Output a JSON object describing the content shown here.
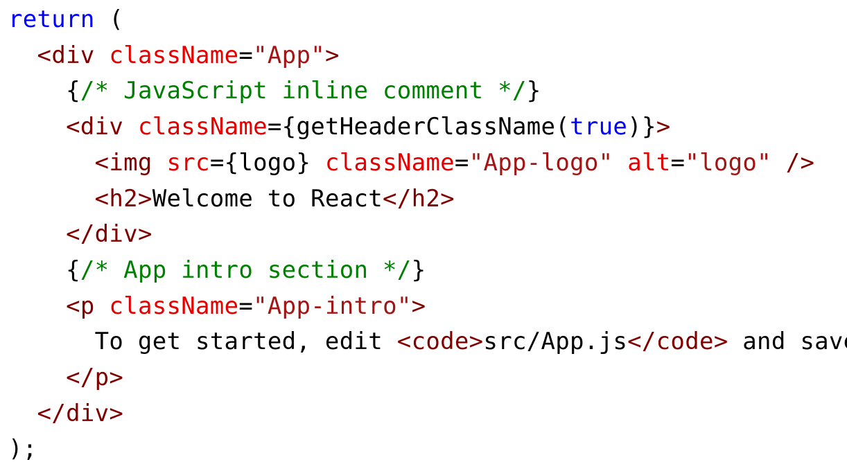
{
  "colors": {
    "plain": "#000000",
    "keyword": "#0000ff",
    "tag": "#800000",
    "attr": "#e50000",
    "string": "#a31515",
    "comment": "#008000",
    "background": "#ffffff"
  },
  "code": {
    "language": "jsx",
    "lines": [
      {
        "tokens": [
          {
            "t": "keyword",
            "v": "return"
          },
          {
            "t": "plain",
            "v": " ("
          }
        ]
      },
      {
        "tokens": [
          {
            "t": "plain",
            "v": "  "
          },
          {
            "t": "tag",
            "v": "<div"
          },
          {
            "t": "plain",
            "v": " "
          },
          {
            "t": "attr",
            "v": "className"
          },
          {
            "t": "plain",
            "v": "="
          },
          {
            "t": "string",
            "v": "\"App\""
          },
          {
            "t": "tag",
            "v": ">"
          }
        ]
      },
      {
        "tokens": [
          {
            "t": "plain",
            "v": "    {"
          },
          {
            "t": "comment",
            "v": "/* JavaScript inline comment */"
          },
          {
            "t": "plain",
            "v": "}"
          }
        ]
      },
      {
        "tokens": [
          {
            "t": "plain",
            "v": "    "
          },
          {
            "t": "tag",
            "v": "<div"
          },
          {
            "t": "plain",
            "v": " "
          },
          {
            "t": "attr",
            "v": "className"
          },
          {
            "t": "plain",
            "v": "={getHeaderClassName("
          },
          {
            "t": "keyword",
            "v": "true"
          },
          {
            "t": "plain",
            "v": ")}"
          },
          {
            "t": "tag",
            "v": ">"
          }
        ]
      },
      {
        "tokens": [
          {
            "t": "plain",
            "v": "      "
          },
          {
            "t": "tag",
            "v": "<img"
          },
          {
            "t": "plain",
            "v": " "
          },
          {
            "t": "attr",
            "v": "src"
          },
          {
            "t": "plain",
            "v": "={logo} "
          },
          {
            "t": "attr",
            "v": "className"
          },
          {
            "t": "plain",
            "v": "="
          },
          {
            "t": "string",
            "v": "\"App-logo\""
          },
          {
            "t": "plain",
            "v": " "
          },
          {
            "t": "attr",
            "v": "alt"
          },
          {
            "t": "plain",
            "v": "="
          },
          {
            "t": "string",
            "v": "\"logo\""
          },
          {
            "t": "plain",
            "v": " "
          },
          {
            "t": "tag",
            "v": "/>"
          }
        ]
      },
      {
        "tokens": [
          {
            "t": "plain",
            "v": "      "
          },
          {
            "t": "tag",
            "v": "<h2>"
          },
          {
            "t": "plain",
            "v": "Welcome to React"
          },
          {
            "t": "tag",
            "v": "</h2>"
          }
        ]
      },
      {
        "tokens": [
          {
            "t": "plain",
            "v": "    "
          },
          {
            "t": "tag",
            "v": "</div>"
          }
        ]
      },
      {
        "tokens": [
          {
            "t": "plain",
            "v": "    {"
          },
          {
            "t": "comment",
            "v": "/* App intro section */"
          },
          {
            "t": "plain",
            "v": "}"
          }
        ]
      },
      {
        "tokens": [
          {
            "t": "plain",
            "v": "    "
          },
          {
            "t": "tag",
            "v": "<p"
          },
          {
            "t": "plain",
            "v": " "
          },
          {
            "t": "attr",
            "v": "className"
          },
          {
            "t": "plain",
            "v": "="
          },
          {
            "t": "string",
            "v": "\"App-intro\""
          },
          {
            "t": "tag",
            "v": ">"
          }
        ]
      },
      {
        "tokens": [
          {
            "t": "plain",
            "v": "      To get started, edit "
          },
          {
            "t": "tag",
            "v": "<code>"
          },
          {
            "t": "plain",
            "v": "src/App.js"
          },
          {
            "t": "tag",
            "v": "</code>"
          },
          {
            "t": "plain",
            "v": " and save"
          }
        ]
      },
      {
        "tokens": [
          {
            "t": "plain",
            "v": "    "
          },
          {
            "t": "tag",
            "v": "</p>"
          }
        ]
      },
      {
        "tokens": [
          {
            "t": "plain",
            "v": "  "
          },
          {
            "t": "tag",
            "v": "</div>"
          }
        ]
      },
      {
        "tokens": [
          {
            "t": "plain",
            "v": ");"
          }
        ]
      }
    ]
  }
}
